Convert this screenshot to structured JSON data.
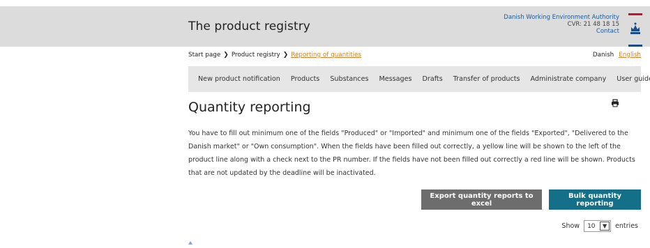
{
  "header": {
    "title": "The product registry",
    "authority_name": "Danish Working Environment Authority",
    "cvr": "CVR: 21 48 18 15",
    "contact": "Contact"
  },
  "breadcrumb": {
    "items": [
      "Start page",
      "Product registry",
      "Reporting of quantities"
    ]
  },
  "language": {
    "danish": "Danish",
    "english": "English"
  },
  "nav": {
    "items": [
      "New product notification",
      "Products",
      "Substances",
      "Messages",
      "Drafts",
      "Transfer of products",
      "Administrate company",
      "User guide"
    ]
  },
  "page": {
    "title": "Quantity reporting",
    "description": "You have to fill out minimum one of the fields \"Produced\" or \"Imported\" and minimum one of the fields \"Exported\", \"Delivered to the Danish market\" or \"Own consumption\". When the fields have been filled out correctly, a yellow line will be shown to the left of the product line along with a check next to the PR number. If the fields have not been filled out correctly a red line will be shown. Products that are not updated by the deadline will be inactivated."
  },
  "actions": {
    "export_label": "Export quantity reports to excel",
    "bulk_label": "Bulk quantity reporting"
  },
  "entries": {
    "show_label": "Show",
    "value": "10",
    "entries_label": "entries"
  },
  "colors": {
    "accent_orange": "#d9822b",
    "bulk_button": "#147089",
    "export_button": "#6d6d6d",
    "header_bg": "#dcdcdc",
    "nav_bg": "#e6e6e6"
  }
}
